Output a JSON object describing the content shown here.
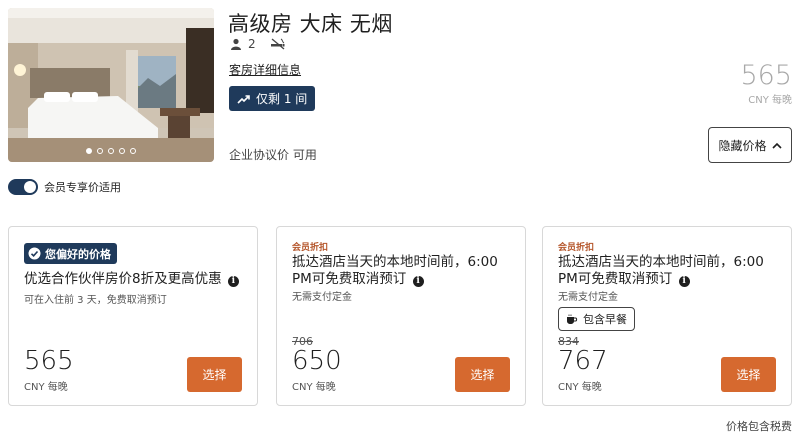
{
  "room": {
    "title": "高级房 大床 无烟",
    "guests": "2",
    "details_link": "客房详细信息",
    "scarcity": "仅剩 1 间",
    "corporate_rate": "企业协议价 可用",
    "photo_slide_count": 5,
    "photo_active_index": 0
  },
  "header_price": {
    "amount": "565",
    "unit": "CNY 每晚"
  },
  "hide_button": {
    "label": "隐藏价格"
  },
  "member_toggle": {
    "label": "会员专享价适用",
    "on": true
  },
  "rates": [
    {
      "badge": "您偏好的价格",
      "title": "优选合作伙伴房价8折及更高优惠",
      "subtitle": "可在入住前 3 天，免费取消预订",
      "price": "565",
      "unit": "CNY 每晚",
      "button": "选择"
    },
    {
      "tag": "会员折扣",
      "title": "抵达酒店当天的本地时间前，6:00 PM可免费取消预订",
      "subtitle": "无需支付定金",
      "original_price": "706",
      "price": "650",
      "unit": "CNY 每晚",
      "button": "选择"
    },
    {
      "tag": "会员折扣",
      "title": "抵达酒店当天的本地时间前，6:00 PM可免费取消预订",
      "subtitle": "无需支付定金",
      "amenity": "包含早餐",
      "original_price": "834",
      "price": "767",
      "unit": "CNY 每晚",
      "button": "选择"
    }
  ],
  "footer": {
    "tax_note": "价格包含税费"
  },
  "colors": {
    "navy": "#1f3a5b",
    "accent_orange": "#d6692f",
    "member_tag": "#b5562b",
    "muted_price": "#a8a8a8"
  },
  "icons": [
    "person-icon",
    "no-smoking-icon",
    "trend-up-icon",
    "chevron-up-icon",
    "check-badge-icon",
    "info-icon",
    "coffee-cup-icon"
  ]
}
